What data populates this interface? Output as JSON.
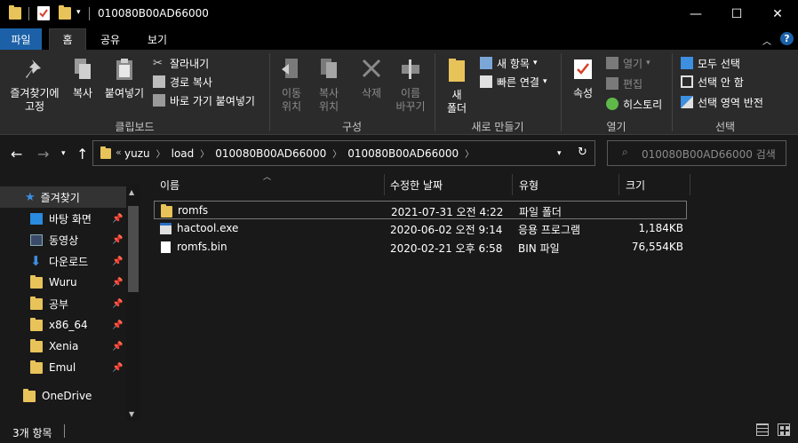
{
  "window": {
    "title": "010080B00AD66000",
    "controls": {
      "minimize": "—",
      "maximize": "☐",
      "close": "✕"
    }
  },
  "ribbon_tabs": [
    "파일",
    "홈",
    "공유",
    "보기"
  ],
  "ribbon": {
    "clipboard": {
      "pin": "즐겨찾기에\n고정",
      "copy": "복사",
      "paste": "붙여넣기",
      "cut": "잘라내기",
      "copy_path": "경로 복사",
      "paste_shortcut": "바로 가기 붙여넣기",
      "label": "클립보드"
    },
    "organize": {
      "move_to": "이동\n위치",
      "copy_to": "복사\n위치",
      "delete": "삭제",
      "rename": "이름\n바꾸기",
      "label": "구성"
    },
    "new": {
      "new_folder": "새\n폴더",
      "new_item": "새 항목",
      "easy_access": "빠른 연결",
      "label": "새로 만들기"
    },
    "open": {
      "properties": "속성",
      "open": "열기",
      "edit": "편집",
      "history": "히스토리",
      "label": "열기"
    },
    "select": {
      "select_all": "모두 선택",
      "select_none": "선택 안 함",
      "invert": "선택 영역 반전",
      "label": "선택"
    }
  },
  "address": {
    "crumbs": [
      "yuzu",
      "load",
      "010080B00AD66000",
      "010080B00AD66000"
    ],
    "search_placeholder": "010080B00AD66000 검색"
  },
  "nav": {
    "quick_access": "즐겨찾기",
    "items": [
      {
        "label": "바탕 화면"
      },
      {
        "label": "동영상"
      },
      {
        "label": "다운로드"
      },
      {
        "label": "Wuru"
      },
      {
        "label": "공부"
      },
      {
        "label": "x86_64"
      },
      {
        "label": "Xenia"
      },
      {
        "label": "Emul"
      }
    ],
    "onedrive": "OneDrive"
  },
  "columns": {
    "name": "이름",
    "modified": "수정한 날짜",
    "type": "유형",
    "size": "크기"
  },
  "files": [
    {
      "name": "romfs",
      "modified": "2021-07-31 오전 4:22",
      "type": "파일 폴더",
      "size": ""
    },
    {
      "name": "hactool.exe",
      "modified": "2020-06-02 오전 9:14",
      "type": "응용 프로그램",
      "size": "1,184KB"
    },
    {
      "name": "romfs.bin",
      "modified": "2020-02-21 오후 6:58",
      "type": "BIN 파일",
      "size": "76,554KB"
    }
  ],
  "status": {
    "count": "3개 항목"
  },
  "colors": {
    "accent": "#1c61a8",
    "folder": "#e8c35a",
    "background": "#191919",
    "ribbon": "#2b2b2b"
  }
}
